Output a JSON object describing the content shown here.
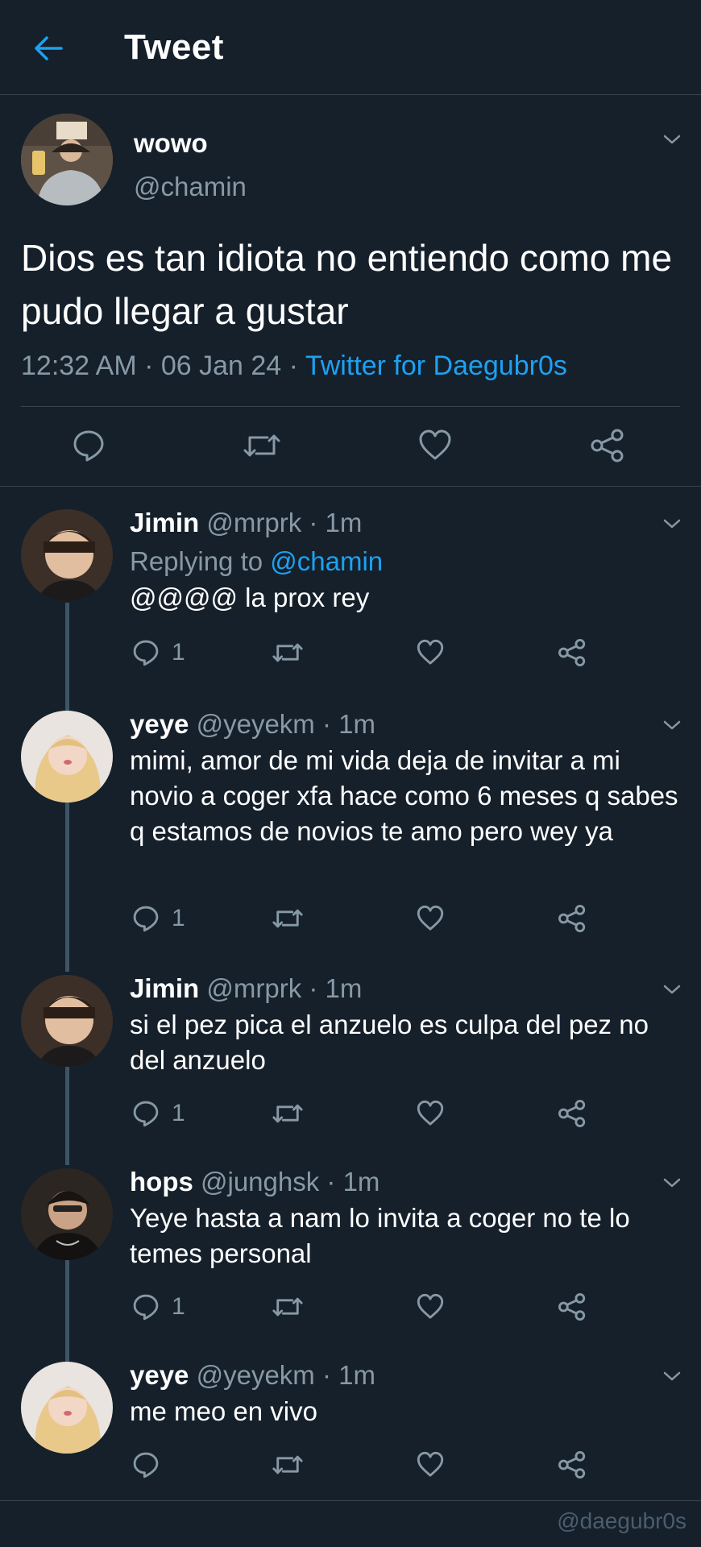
{
  "header": {
    "title": "Tweet"
  },
  "main_tweet": {
    "name": "wowo",
    "handle": "@chamin",
    "text": "Dios es tan idiota no entiendo como me pudo llegar a gustar",
    "time": "12:32 AM · 06 Jan 24 · ",
    "source": "Twitter for Daegubr0s"
  },
  "replies": [
    {
      "name": "Jimin",
      "handle": "@mrprk",
      "time": "· 1m",
      "replying_prefix": "Replying to ",
      "replying_to": "@chamin",
      "text": "@@@@ la prox rey",
      "reply_count": "1"
    },
    {
      "name": "yeye",
      "handle": "@yeyekm",
      "time": "· 1m",
      "text": "mimi, amor de mi vida deja de invitar a mi novio a coger xfa hace como 6 meses q sabes q estamos de novios te amo pero wey ya",
      "reply_count": "1"
    },
    {
      "name": "Jimin",
      "handle": "@mrprk",
      "time": "· 1m",
      "text": "si el pez pica el anzuelo es culpa del pez no del anzuelo",
      "reply_count": "1"
    },
    {
      "name": "hops",
      "handle": "@junghsk",
      "time": "· 1m",
      "text": "Yeye hasta a nam lo invita a coger no te lo temes personal",
      "reply_count": "1"
    },
    {
      "name": "yeye",
      "handle": "@yeyekm",
      "time": "· 1m",
      "text": "me meo en vivo",
      "reply_count": ""
    }
  ],
  "watermark": "@daegubr0s",
  "colors": {
    "background": "#15202b",
    "accent": "#1da1f2",
    "muted": "#8899a6",
    "divider": "#38444d"
  },
  "icons": [
    "back-arrow-icon",
    "chevron-down-icon",
    "reply-icon",
    "retweet-icon",
    "like-icon",
    "share-icon"
  ]
}
